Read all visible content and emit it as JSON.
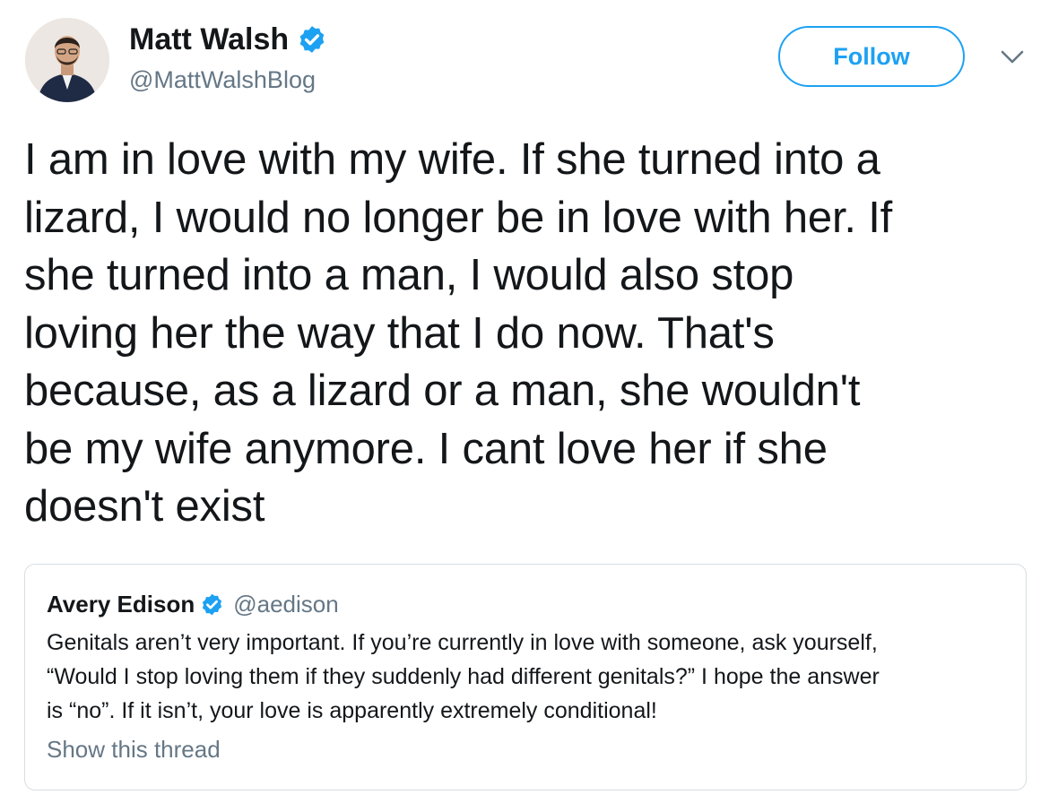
{
  "author": {
    "name": "Matt Walsh",
    "handle": "@MattWalshBlog",
    "verified": true
  },
  "follow_button": {
    "label": "Follow"
  },
  "more_menu_icon": "chevron-down-icon",
  "tweet": {
    "lines": [
      "I am in love with my wife. If she turned into a",
      "lizard, I would no longer be in love with her. If",
      "she turned into a man, I would also stop",
      "loving her the way that I do now. That's",
      "because, as a lizard or a man, she wouldn't",
      "be my wife anymore. I cant love her if she",
      "doesn't exist"
    ]
  },
  "quoted_tweet": {
    "name": "Avery Edison",
    "handle": "@aedison",
    "verified": true,
    "lines": [
      "Genitals aren’t very important. If you’re currently in love with someone, ask yourself,",
      "“Would I stop loving them if they suddenly had different genitals?” I hope the answer",
      "is “no”. If it isn’t, your love is apparently extremely conditional!"
    ],
    "show_thread_label": "Show this thread"
  },
  "colors": {
    "accent": "#1da1f2",
    "text": "#14171a",
    "secondary_text": "#657786",
    "border": "#d8dee3"
  }
}
